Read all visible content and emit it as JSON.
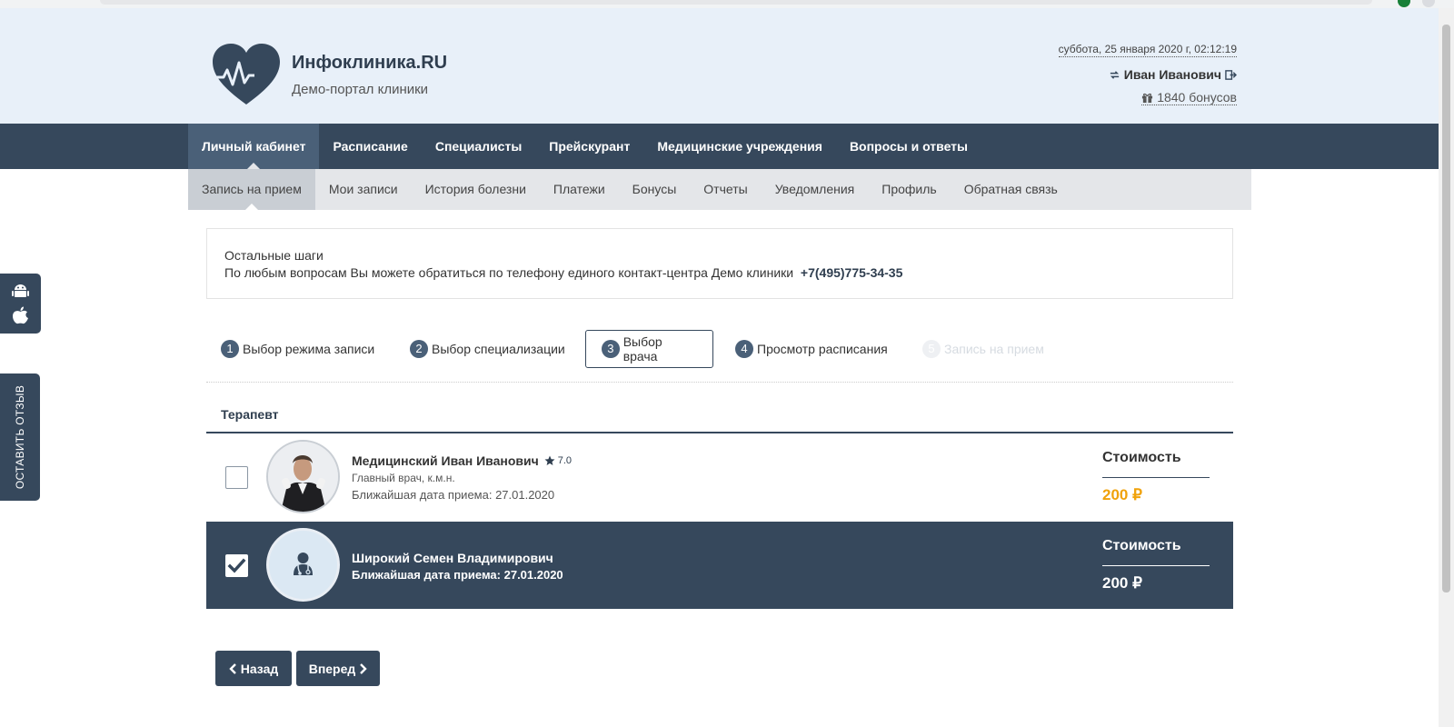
{
  "header": {
    "site_name": "Инфоклиника.RU",
    "site_subtitle": "Демо-портал клиники",
    "datetime": "суббота, 25 января 2020 г, 02:12:19",
    "user_name": "Иван Иванович",
    "bonus": "1840 бонусов"
  },
  "main_nav": [
    "Личный кабинет",
    "Расписание",
    "Специалисты",
    "Прейскурант",
    "Медицинские учреждения",
    "Вопросы и ответы"
  ],
  "sub_nav": [
    "Запись на прием",
    "Мои записи",
    "История болезни",
    "Платежи",
    "Бонусы",
    "Отчеты",
    "Уведомления",
    "Профиль",
    "Обратная связь"
  ],
  "side": {
    "review_label": "ОСТАВИТЬ ОТЗЫВ"
  },
  "info": {
    "line1": "Остальные шаги",
    "line2": "По любым вопросам Вы можете обратиться по телефону единого контакт-центра Демо клиники",
    "phone": "+7(495)775-34-35"
  },
  "steps": [
    {
      "num": "1",
      "label": "Выбор режима записи",
      "state": "done"
    },
    {
      "num": "2",
      "label": "Выбор специализации",
      "state": "done"
    },
    {
      "num": "3",
      "label": "Выбор врача",
      "state": "current"
    },
    {
      "num": "4",
      "label": "Просмотр расписания",
      "state": "done"
    },
    {
      "num": "5",
      "label": "Запись на прием",
      "state": "disabled"
    }
  ],
  "specialization": "Терапевт",
  "doctors": [
    {
      "name": "Медицинский Иван Иванович",
      "rating": "7.0",
      "position": "Главный врач, к.м.н.",
      "nearest_date": "Ближайшая дата приема: 27.01.2020",
      "price_label": "Стоимость",
      "price": "200 ₽",
      "selected": false
    },
    {
      "name": "Широкий Семен Владимирович",
      "nearest_date": "Ближайшая дата приема: 27.01.2020",
      "price_label": "Стоимость",
      "price": "200 ₽",
      "selected": true
    }
  ],
  "buttons": {
    "back": "Назад",
    "next": "Вперед"
  },
  "colors": {
    "primary": "#36485c",
    "header_bg": "#e8f0f9",
    "price_accent": "#f0a20b"
  }
}
